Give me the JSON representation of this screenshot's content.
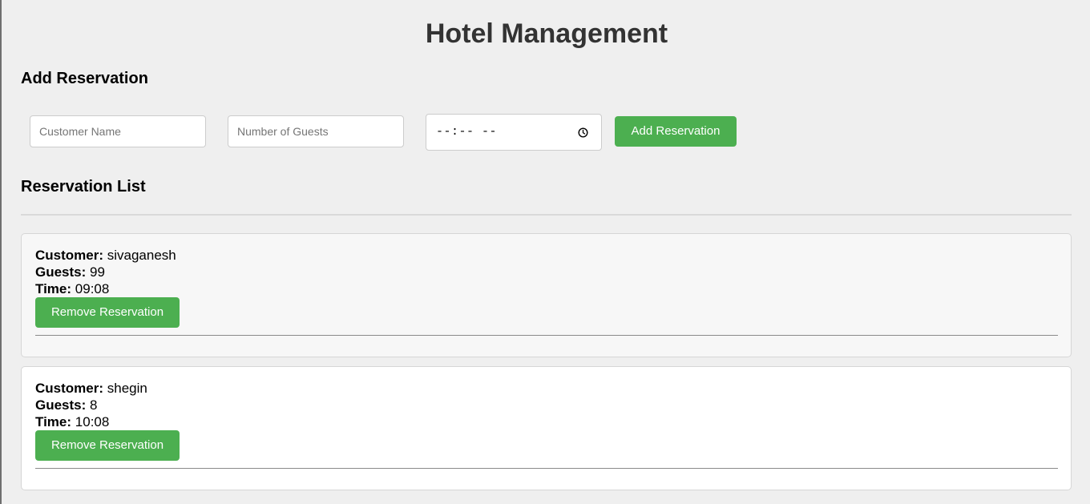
{
  "title": "Hotel Management",
  "add_section": {
    "heading": "Add Reservation",
    "name_placeholder": "Customer Name",
    "guests_placeholder": "Number of Guests",
    "time_display": "--:-- --",
    "button_label": "Add Reservation"
  },
  "list_section": {
    "heading": "Reservation List",
    "reservations": [
      {
        "customer_label": "Customer:",
        "customer": "sivaganesh",
        "guests_label": "Guests:",
        "guests": "99",
        "time_label": "Time:",
        "time": "09:08",
        "remove_label": "Remove Reservation"
      },
      {
        "customer_label": "Customer:",
        "customer": "shegin",
        "guests_label": "Guests:",
        "guests": "8",
        "time_label": "Time:",
        "time": "10:08",
        "remove_label": "Remove Reservation"
      }
    ]
  },
  "colors": {
    "accent": "#4caf50",
    "background": "#efefef",
    "title_text": "#333333"
  },
  "icons": {
    "time_picker": "clock-icon"
  }
}
